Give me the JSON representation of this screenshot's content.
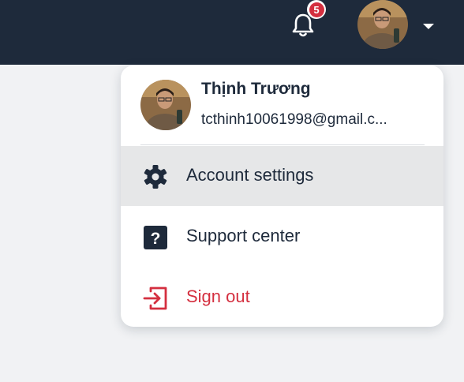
{
  "topbar": {
    "notifications_count": "5",
    "icons": {
      "bell": "bell-icon",
      "caret": "caret-down-icon"
    },
    "colors": {
      "background": "#1e2a3b",
      "badge": "#d42f3f"
    }
  },
  "account_menu": {
    "user": {
      "name": "Thịnh Trương",
      "email": "tcthinh10061998@gmail.c..."
    },
    "items": [
      {
        "label": "Account settings",
        "icon": "gear-icon",
        "active": true
      },
      {
        "label": "Support center",
        "icon": "question-square-icon",
        "active": false
      },
      {
        "label": "Sign out",
        "icon": "sign-out-icon",
        "active": false,
        "danger": true
      }
    ],
    "colors": {
      "text": "#1e2a3b",
      "danger": "#d42f3f",
      "active_bg": "#e6e7e8"
    }
  }
}
